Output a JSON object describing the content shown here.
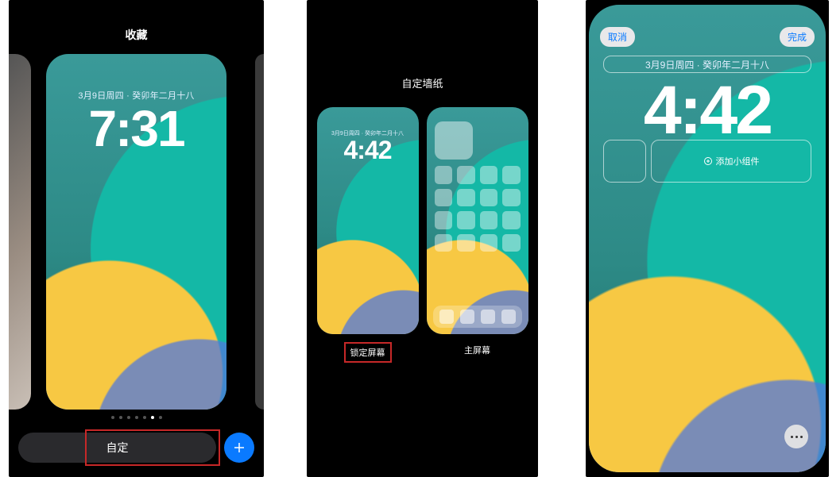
{
  "panel1": {
    "header": "收藏",
    "date": "3月9日周四 · 癸卯年二月十八",
    "time": "7:31",
    "pager_count": 7,
    "pager_active": 5,
    "customize_label": "自定",
    "add_label": "+"
  },
  "panel2": {
    "header": "自定墙纸",
    "date": "3月9日周四 · 癸卯年二月十八",
    "time": "4:42",
    "lock_label": "锁定屏幕",
    "home_label": "主屏幕"
  },
  "panel3": {
    "cancel": "取消",
    "done": "完成",
    "date": "3月9日周四 · 癸卯年二月十八",
    "time": "4:42",
    "add_widget": "添加小组件"
  }
}
